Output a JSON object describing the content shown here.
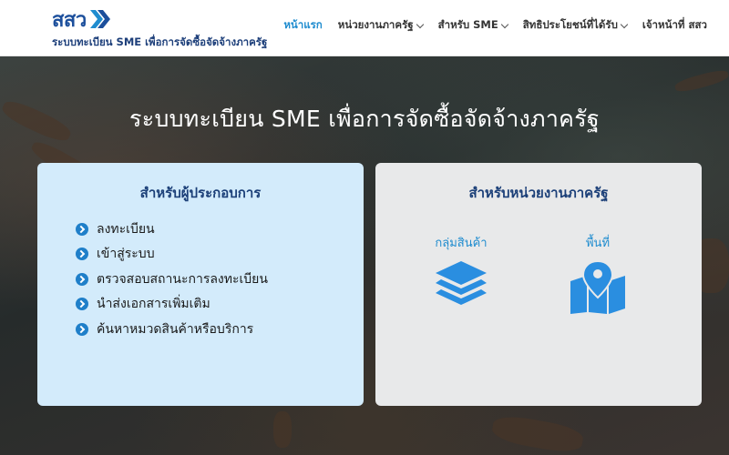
{
  "header": {
    "logo_text": "สสว",
    "subtitle": "ระบบทะเบียน SME เพื่อการจัดซื้อจัดจ้างภาครัฐ",
    "nav": [
      {
        "label": "หน้าแรก",
        "active": true,
        "dropdown": false
      },
      {
        "label": "หน่วยงานภาครัฐ",
        "active": false,
        "dropdown": true
      },
      {
        "label": "สำหรับ SME",
        "active": false,
        "dropdown": true
      },
      {
        "label": "สิทธิประโยชน์ที่ได้รับ",
        "active": false,
        "dropdown": true
      },
      {
        "label": "เจ้าหน้าที่ สสว",
        "active": false,
        "dropdown": false
      }
    ]
  },
  "hero": {
    "title": "ระบบทะเบียน SME เพื่อการจัดซื้อจัดจ้างภาครัฐ"
  },
  "entrepreneur_card": {
    "title": "สำหรับผู้ประกอบการ",
    "items": [
      "ลงทะเบียน",
      "เข้าสู่ระบบ",
      "ตรวจสอบสถานะการลงทะเบียน",
      "นำส่งเอกสารเพิ่มเติม",
      "ค้นหาหมวดสินค้าหรือบริการ"
    ]
  },
  "government_card": {
    "title": "สำหรับหน่วยงานภาครัฐ",
    "tiles": [
      {
        "label": "กลุ่มสินค้า",
        "icon": "layers-icon"
      },
      {
        "label": "พื้นที่",
        "icon": "map-pin-icon"
      }
    ]
  },
  "colors": {
    "brand_blue": "#1c4f9c",
    "accent_blue": "#1f8ccf",
    "icon_blue": "#2a8ee0",
    "left_card_bg": "#d3ebfb",
    "right_card_bg": "#e8e9ea"
  }
}
